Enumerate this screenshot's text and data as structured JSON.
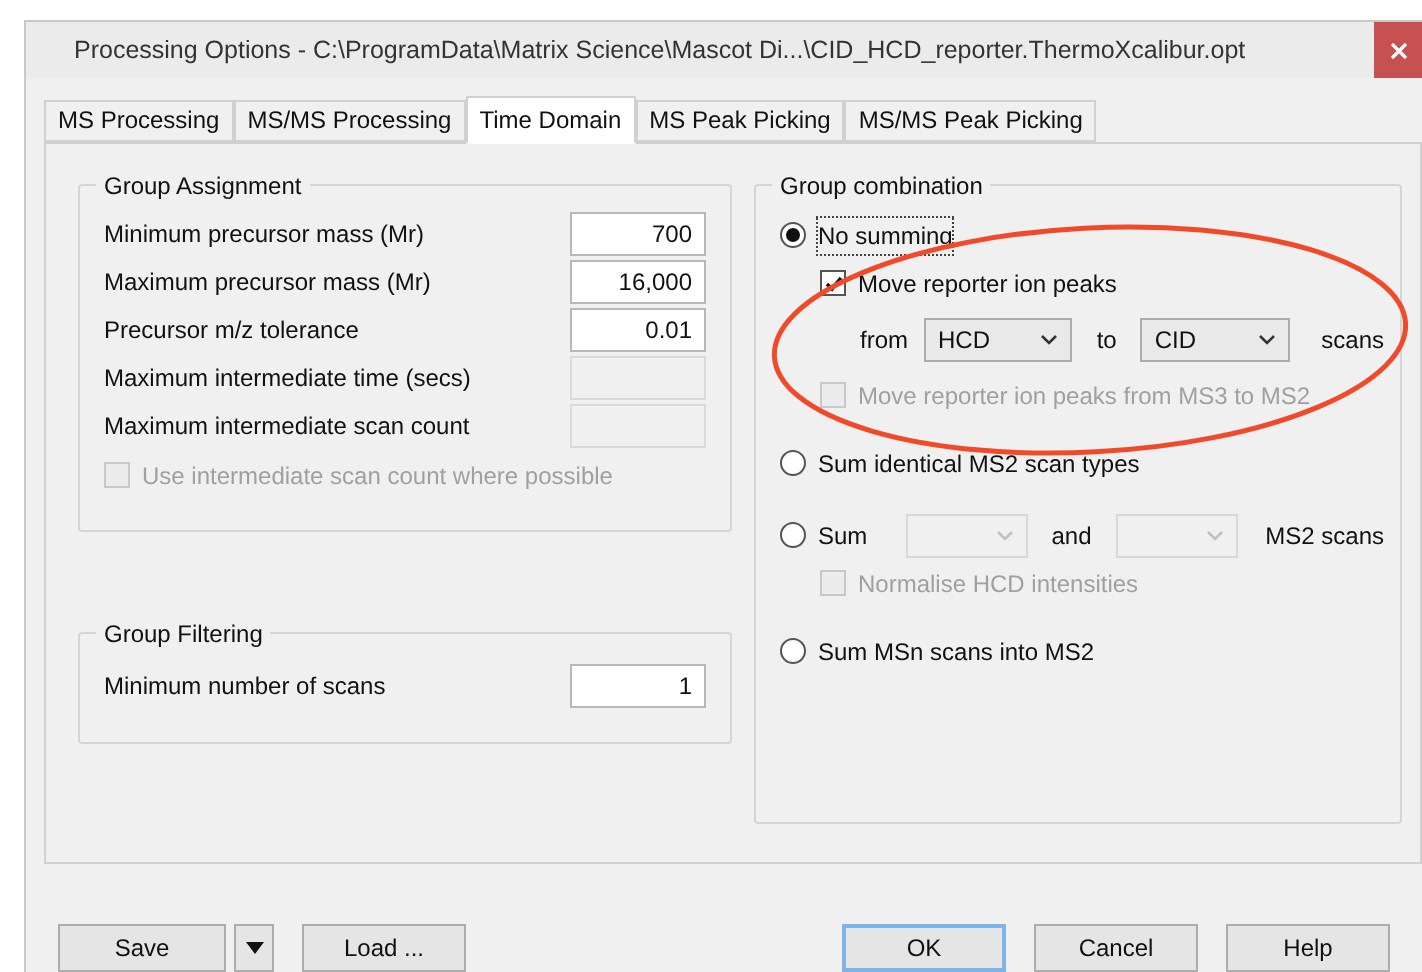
{
  "window": {
    "title": "Processing Options - C:\\ProgramData\\Matrix Science\\Mascot Di...\\CID_HCD_reporter.ThermoXcalibur.opt"
  },
  "tabs": [
    {
      "label": "MS Processing",
      "selected": false
    },
    {
      "label": "MS/MS Processing",
      "selected": false
    },
    {
      "label": "Time Domain",
      "selected": true
    },
    {
      "label": "MS Peak Picking",
      "selected": false
    },
    {
      "label": "MS/MS Peak Picking",
      "selected": false
    }
  ],
  "group_assignment": {
    "title": "Group Assignment",
    "fields": [
      {
        "label": "Minimum precursor mass (Mr)",
        "value": "700",
        "disabled": false
      },
      {
        "label": "Maximum precursor mass (Mr)",
        "value": "16,000",
        "disabled": false
      },
      {
        "label": "Precursor m/z tolerance",
        "value": "0.01",
        "disabled": false
      },
      {
        "label": "Maximum intermediate time (secs)",
        "disabled": true
      },
      {
        "label": "Maximum intermediate scan count",
        "disabled": true
      }
    ],
    "checkbox": {
      "label": "Use intermediate scan count where possible",
      "checked": false,
      "disabled": true
    }
  },
  "group_filtering": {
    "title": "Group Filtering",
    "fields": [
      {
        "label": "Minimum number of scans",
        "value": "1",
        "disabled": false
      }
    ]
  },
  "group_combination": {
    "title": "Group combination",
    "options": [
      {
        "kind": "plain",
        "label": "No summing",
        "selected": true,
        "children": [
          {
            "kind": "checkbox",
            "label": "Move reporter ion peaks",
            "checked": true,
            "disabled": false
          },
          {
            "kind": "move_row",
            "from_label": "from",
            "from_value": "HCD",
            "to_label": "to",
            "to_value": "CID",
            "suffix": "scans"
          },
          {
            "kind": "checkbox",
            "label": "Move reporter ion peaks from MS3 to MS2",
            "checked": false,
            "disabled": true
          }
        ]
      },
      {
        "kind": "plain",
        "label": "Sum identical MS2 scan types",
        "selected": false
      },
      {
        "kind": "sum",
        "label": "Sum",
        "and_label": "and",
        "suffix": "MS2 scans",
        "selected": false,
        "children": [
          {
            "kind": "checkbox",
            "label": "Normalise HCD intensities",
            "checked": false,
            "disabled": true
          }
        ]
      },
      {
        "kind": "plain",
        "label": "Sum MSn scans into MS2",
        "selected": false
      }
    ]
  },
  "left_buttons": [
    {
      "kind": "split",
      "label": "Save"
    },
    {
      "kind": "plain",
      "label": "Load ..."
    }
  ],
  "right_buttons": [
    {
      "kind": "default",
      "label": "OK"
    },
    {
      "kind": "plain",
      "label": "Cancel"
    },
    {
      "kind": "plain",
      "label": "Help"
    }
  ]
}
